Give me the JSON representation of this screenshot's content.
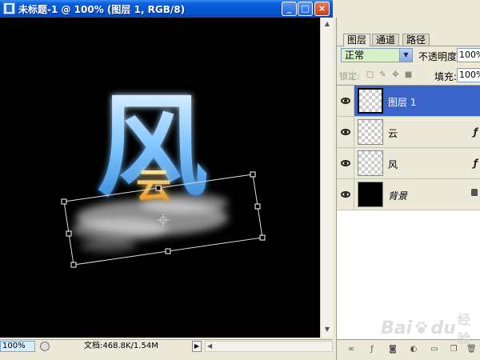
{
  "document": {
    "title": "未标题-1 @ 100% (图层 1, RGB/8)",
    "controls": {
      "minimize": "_",
      "maximize": "□",
      "close": "×"
    },
    "canvas": {
      "char_wind": "风",
      "char_cloud": "云"
    },
    "status": {
      "zoom": "100%",
      "doc_info": "文档:468.8K/1.54M",
      "arrow": "▶"
    }
  },
  "layers_panel": {
    "tabs": [
      {
        "label": "图层",
        "active": true
      },
      {
        "label": "通道",
        "active": false
      },
      {
        "label": "路径",
        "active": false
      }
    ],
    "blend_mode": "正常",
    "opacity_label": "不透明度:",
    "opacity_value": "100%",
    "lock_label": "锁定:",
    "fill_label": "填充:",
    "fill_value": "100%",
    "layers": [
      {
        "name": "图层 1",
        "selected": true,
        "visible": true,
        "fx": false,
        "locked": false,
        "thumb": "transparent"
      },
      {
        "name": "云",
        "selected": false,
        "visible": true,
        "fx": true,
        "locked": false,
        "thumb": "transparent"
      },
      {
        "name": "风",
        "selected": false,
        "visible": true,
        "fx": true,
        "locked": false,
        "thumb": "transparent"
      },
      {
        "name": "背景",
        "selected": false,
        "visible": true,
        "fx": false,
        "locked": true,
        "thumb": "black"
      }
    ],
    "fx_glyph": "ƒ"
  },
  "watermark": {
    "brand": "Bai",
    "brand2": "du",
    "suffix": "经验"
  },
  "colors": {
    "titlebar": "#0553d0",
    "selected_layer": "#3b64c8",
    "blend_field": "#d7f0c7",
    "wind_glow": "#7fc4ff",
    "cloud_glow": "#f0a830"
  }
}
